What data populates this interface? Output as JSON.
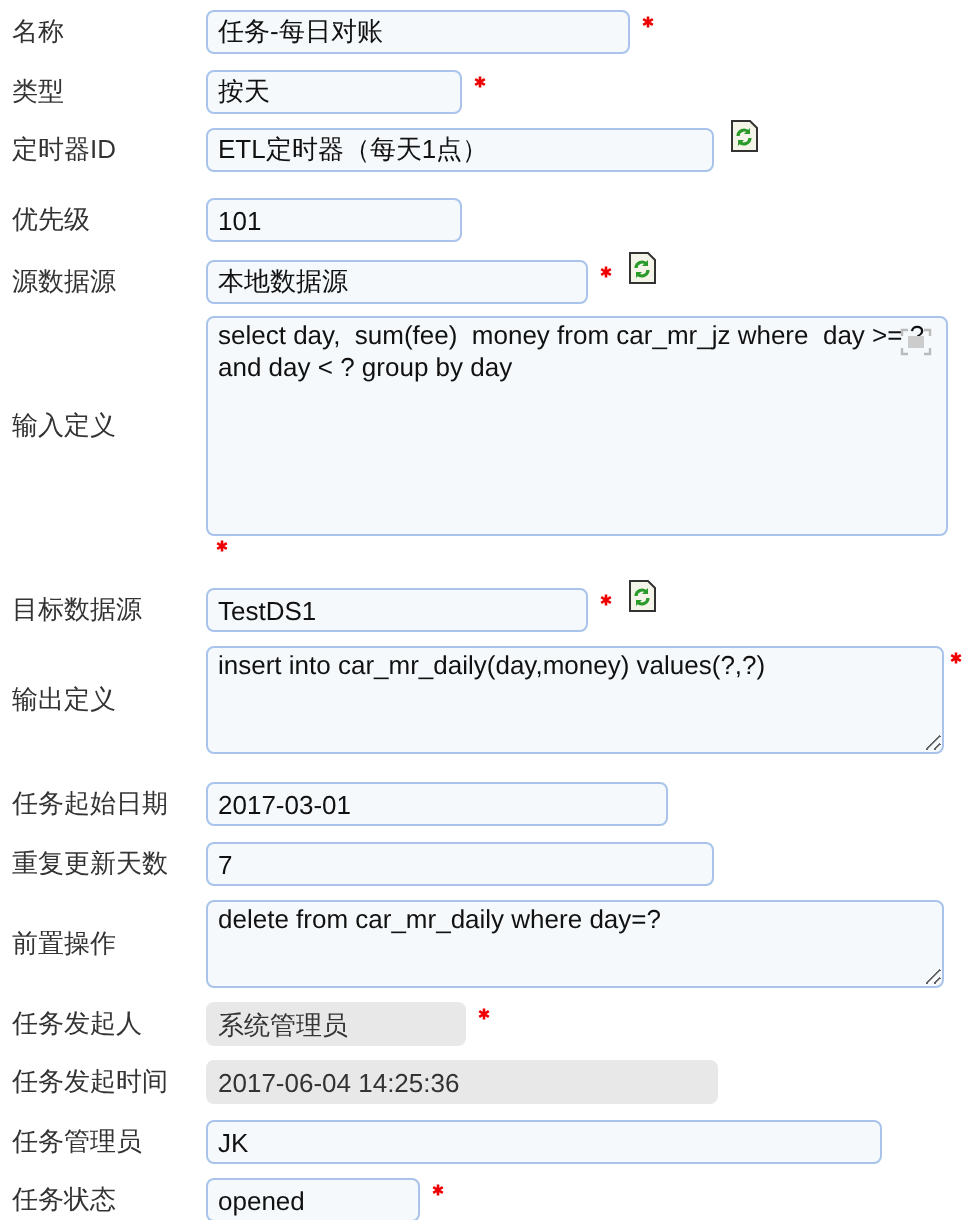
{
  "form": {
    "fields": [
      {
        "label": "名称",
        "kind": "input",
        "value": "任务-每日对账",
        "required": true,
        "refresh_icon": false,
        "expand_icon": false
      },
      {
        "label": "类型",
        "kind": "input",
        "value": "按天",
        "required": true,
        "refresh_icon": false,
        "expand_icon": false
      },
      {
        "label": "定时器ID",
        "kind": "input",
        "value": "ETL定时器（每天1点）",
        "required": false,
        "refresh_icon": true,
        "expand_icon": false
      },
      {
        "label": "优先级",
        "kind": "input",
        "value": "101",
        "required": false,
        "refresh_icon": false,
        "expand_icon": false
      },
      {
        "label": "源数据源",
        "kind": "input",
        "value": "本地数据源",
        "required": true,
        "refresh_icon": true,
        "expand_icon": false
      },
      {
        "label": "输入定义",
        "kind": "textarea",
        "value": "select day,  sum(fee)  money from car_mr_jz where  day >= ?\nand day < ? group by day",
        "required": true,
        "refresh_icon": false,
        "expand_icon": true
      },
      {
        "label": "目标数据源",
        "kind": "input",
        "value": "TestDS1",
        "required": true,
        "refresh_icon": true,
        "expand_icon": false
      },
      {
        "label": "输出定义",
        "kind": "textarea",
        "value": "insert into car_mr_daily(day,money) values(?,?)",
        "required": true,
        "refresh_icon": false,
        "expand_icon": false
      },
      {
        "label": "任务起始日期",
        "kind": "input",
        "value": "2017-03-01",
        "required": false,
        "refresh_icon": false,
        "expand_icon": false
      },
      {
        "label": "重复更新天数",
        "kind": "input",
        "value": "7",
        "required": false,
        "refresh_icon": false,
        "expand_icon": false
      },
      {
        "label": "前置操作",
        "kind": "textarea",
        "value": "delete from car_mr_daily where day=?",
        "required": false,
        "refresh_icon": false,
        "expand_icon": false
      },
      {
        "label": "任务发起人",
        "kind": "readonly",
        "value": "系统管理员",
        "required": true,
        "refresh_icon": false,
        "expand_icon": false
      },
      {
        "label": "任务发起时间",
        "kind": "readonly",
        "value": "2017-06-04 14:25:36",
        "required": false,
        "refresh_icon": false,
        "expand_icon": false
      },
      {
        "label": "任务管理员",
        "kind": "input",
        "value": "JK",
        "required": false,
        "refresh_icon": false,
        "expand_icon": false
      },
      {
        "label": "任务状态",
        "kind": "input",
        "value": "opened",
        "required": true,
        "refresh_icon": false,
        "expand_icon": false
      }
    ]
  }
}
